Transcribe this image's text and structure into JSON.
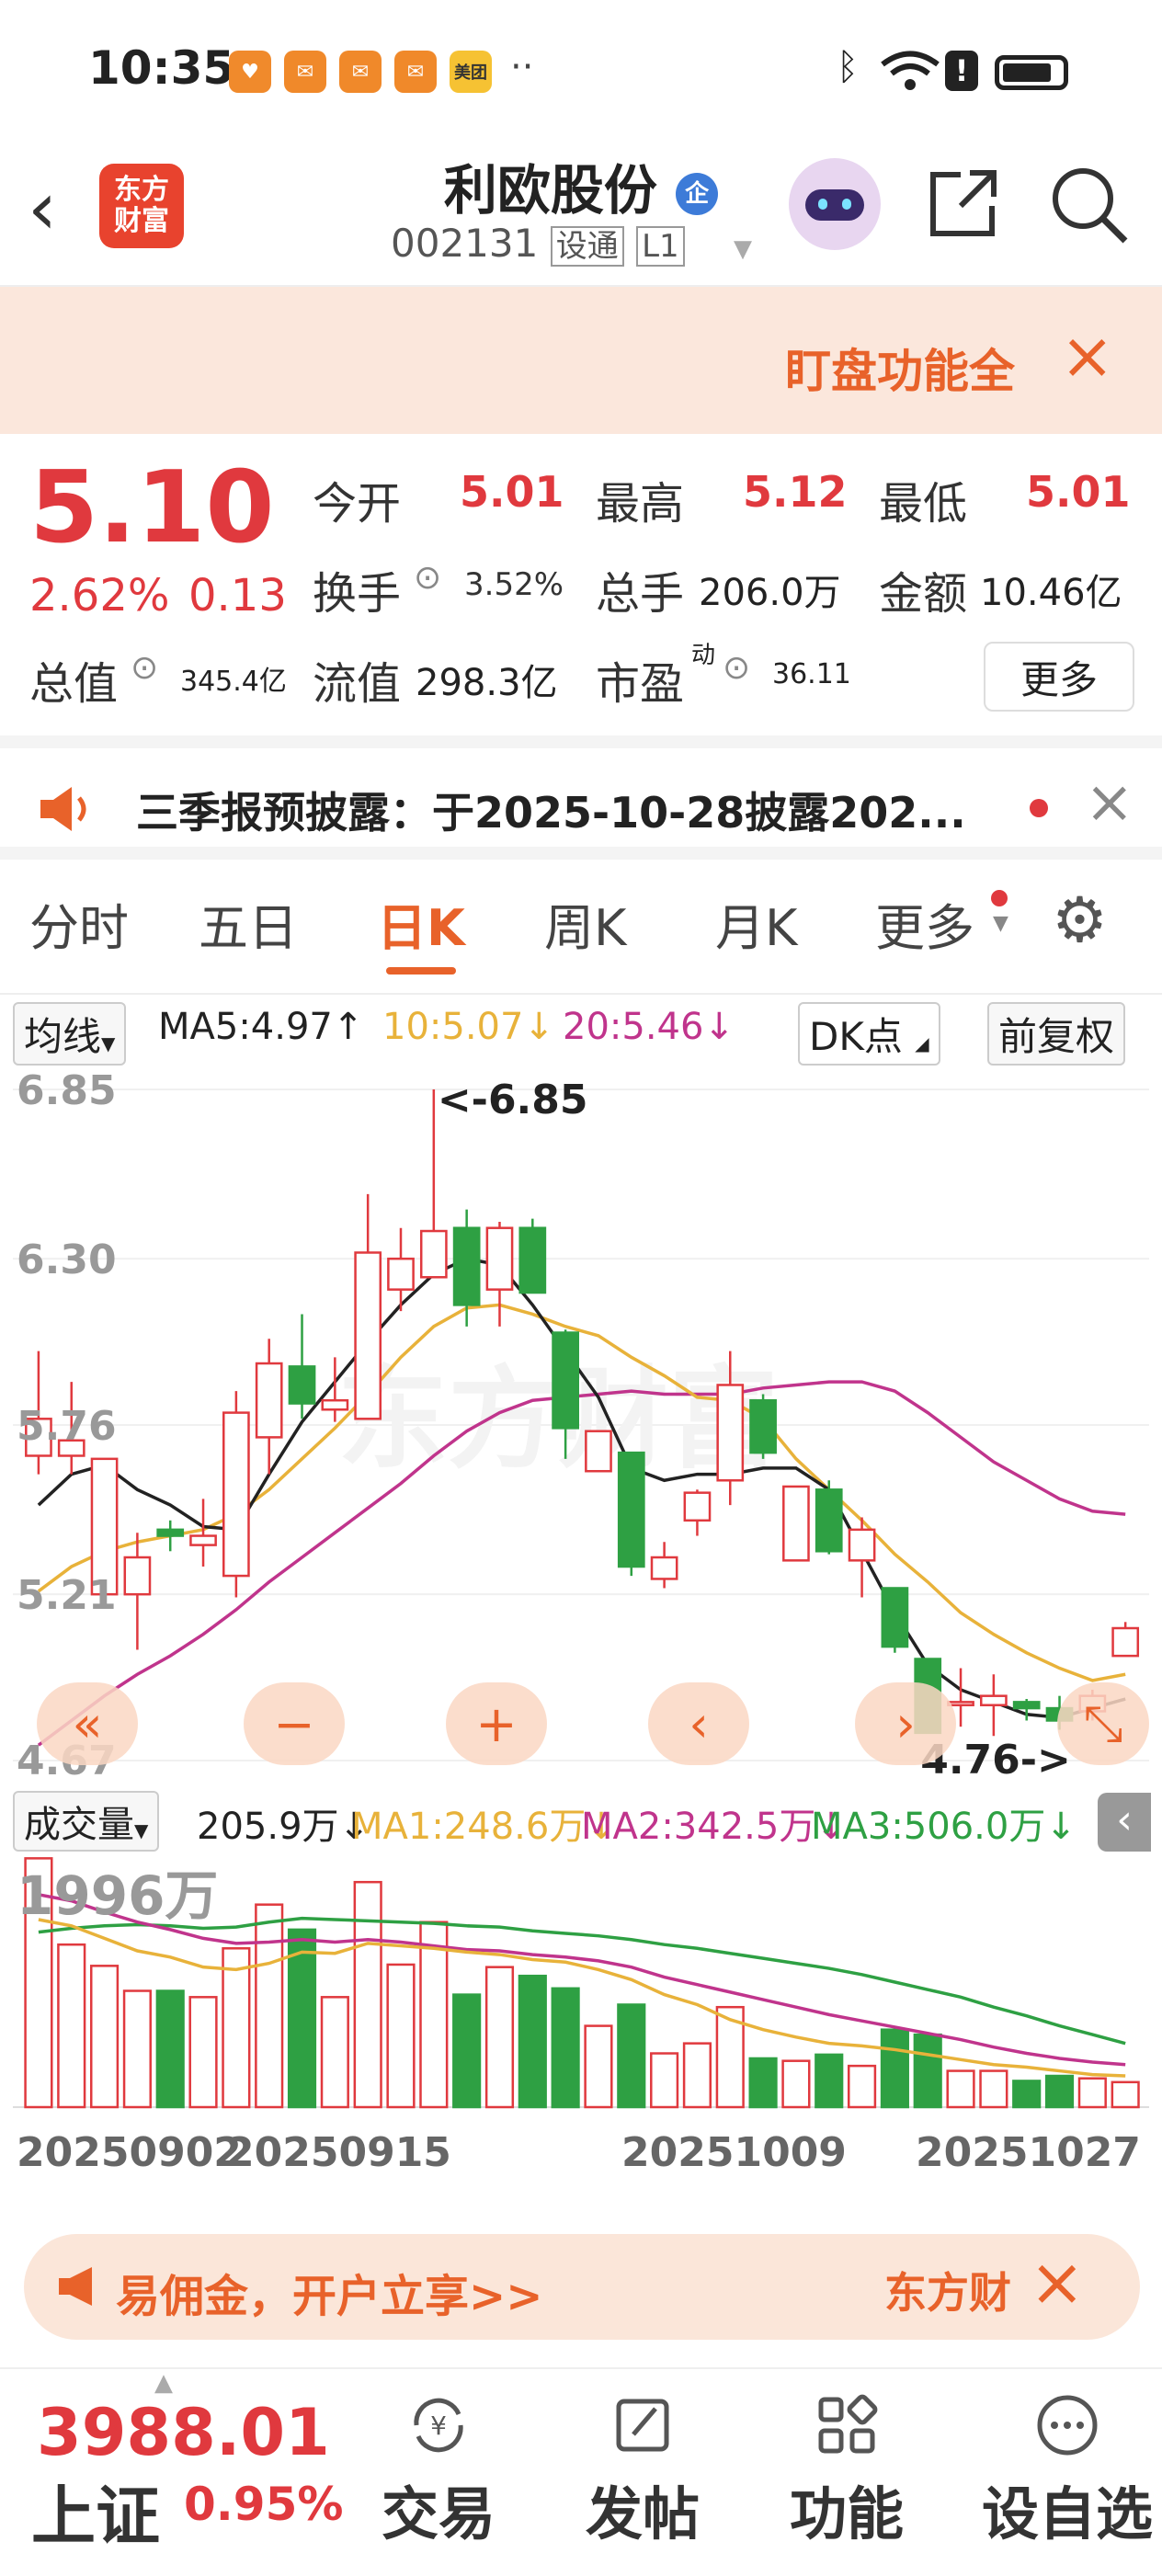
{
  "status_bar": {
    "time": "10:35",
    "notification_icons": [
      "heart-icon",
      "envelope-icon",
      "envelope-icon",
      "envelope-icon",
      "meituan-icon"
    ],
    "meituan_label": "美团",
    "more_dots": "··"
  },
  "header": {
    "logo_text": "东方\n财富",
    "stock_name": "利欧股份",
    "badge": "企",
    "code": "002131",
    "tags": [
      "设通",
      "L1"
    ]
  },
  "banner": {
    "text": "盯盘功能全"
  },
  "quote": {
    "price": "5.10",
    "change_pct": "2.62%",
    "change": "0.13",
    "open_label": "今开",
    "open": "5.01",
    "high_label": "最高",
    "high": "5.12",
    "low_label": "最低",
    "low": "5.01",
    "turnover_label": "换手",
    "turnover": "3.52%",
    "volume_label": "总手",
    "volume": "206.0万",
    "amount_label": "金额",
    "amount": "10.46亿",
    "mktcap_label": "总值",
    "mktcap": "345.4亿",
    "float_label": "流值",
    "float": "298.3亿",
    "pe_label": "市盈",
    "pe_sup": "动",
    "pe": "36.11",
    "more": "更多"
  },
  "notice": {
    "text": "三季报预披露：于2025-10-28披露202..."
  },
  "tabs": [
    "分时",
    "五日",
    "日K",
    "周K",
    "月K",
    "更多"
  ],
  "ma_row": {
    "selector": "均线",
    "ma5": "MA5:4.97↑",
    "ma10": "10:5.07↓",
    "ma20": "20:5.46↓",
    "dk": "DK点",
    "adjust": "前复权",
    "colors": {
      "ma5": "#222222",
      "ma10": "#e8b23a",
      "ma20": "#c0348c"
    }
  },
  "volume_row": {
    "selector": "成交量",
    "vol": "205.9万↓",
    "ma1": "MA1:248.6万↓",
    "ma2": "MA2:342.5万↓",
    "ma3": "MA3:506.0万↓"
  },
  "chart_data": [
    {
      "type": "candlestick",
      "y_ticks": [
        "6.85",
        "6.30",
        "5.76",
        "5.21",
        "4.67"
      ],
      "ylim": [
        4.67,
        6.85
      ],
      "annotations": [
        "<-6.85",
        "4.76->"
      ],
      "candles": [
        {
          "o": 5.66,
          "c": 5.78,
          "h": 6.0,
          "l": 5.6
        },
        {
          "o": 5.66,
          "c": 5.71,
          "h": 5.9,
          "l": 5.6
        },
        {
          "o": 5.21,
          "c": 5.65,
          "h": 5.65,
          "l": 5.2
        },
        {
          "o": 5.21,
          "c": 5.33,
          "h": 5.41,
          "l": 5.03
        },
        {
          "o": 5.42,
          "c": 5.4,
          "h": 5.45,
          "l": 5.35
        },
        {
          "o": 5.37,
          "c": 5.4,
          "h": 5.52,
          "l": 5.3
        },
        {
          "o": 5.27,
          "c": 5.8,
          "h": 5.87,
          "l": 5.2
        },
        {
          "o": 5.72,
          "c": 5.96,
          "h": 6.04,
          "l": 5.6
        },
        {
          "o": 5.95,
          "c": 5.83,
          "h": 6.12,
          "l": 5.78
        },
        {
          "o": 5.81,
          "c": 5.84,
          "h": 5.98,
          "l": 5.77
        },
        {
          "o": 5.78,
          "c": 6.32,
          "h": 6.51,
          "l": 5.78
        },
        {
          "o": 6.2,
          "c": 6.3,
          "h": 6.4,
          "l": 6.13
        },
        {
          "o": 6.24,
          "c": 6.39,
          "h": 6.85,
          "l": 6.24
        },
        {
          "o": 6.4,
          "c": 6.15,
          "h": 6.46,
          "l": 6.08
        },
        {
          "o": 6.2,
          "c": 6.4,
          "h": 6.42,
          "l": 6.08
        },
        {
          "o": 6.4,
          "c": 6.19,
          "h": 6.43,
          "l": 6.19
        },
        {
          "o": 6.06,
          "c": 5.75,
          "h": 6.07,
          "l": 5.65
        },
        {
          "o": 5.61,
          "c": 5.74,
          "h": 5.74,
          "l": 5.61
        },
        {
          "o": 5.67,
          "c": 5.3,
          "h": 5.67,
          "l": 5.27
        },
        {
          "o": 5.26,
          "c": 5.33,
          "h": 5.38,
          "l": 5.23
        },
        {
          "o": 5.45,
          "c": 5.54,
          "h": 5.55,
          "l": 5.4
        },
        {
          "o": 5.58,
          "c": 5.89,
          "h": 6.0,
          "l": 5.5
        },
        {
          "o": 5.84,
          "c": 5.67,
          "h": 5.86,
          "l": 5.65
        },
        {
          "o": 5.32,
          "c": 5.56,
          "h": 5.56,
          "l": 5.32
        },
        {
          "o": 5.55,
          "c": 5.35,
          "h": 5.58,
          "l": 5.34
        },
        {
          "o": 5.32,
          "c": 5.42,
          "h": 5.46,
          "l": 5.2
        },
        {
          "o": 5.23,
          "c": 5.04,
          "h": 5.23,
          "l": 5.02
        },
        {
          "o": 5.0,
          "c": 4.76,
          "h": 5.0,
          "l": 4.76
        },
        {
          "o": 4.85,
          "c": 4.86,
          "h": 4.97,
          "l": 4.78
        },
        {
          "o": 4.85,
          "c": 4.88,
          "h": 4.95,
          "l": 4.75
        },
        {
          "o": 4.86,
          "c": 4.84,
          "h": 4.87,
          "l": 4.8
        },
        {
          "o": 4.84,
          "c": 4.8,
          "h": 4.88,
          "l": 4.77
        },
        {
          "o": 4.83,
          "c": 4.88,
          "h": 4.9,
          "l": 4.8
        },
        {
          "o": 5.01,
          "c": 5.1,
          "h": 5.12,
          "l": 5.01
        }
      ],
      "ma5": [
        5.5,
        5.6,
        5.63,
        5.55,
        5.5,
        5.43,
        5.42,
        5.6,
        5.77,
        5.9,
        6.03,
        6.15,
        6.25,
        6.3,
        6.28,
        6.15,
        6.0,
        5.85,
        5.62,
        5.58,
        5.6,
        5.6,
        5.62,
        5.62,
        5.55,
        5.35,
        5.15,
        4.98,
        4.9,
        4.86,
        4.82,
        4.81,
        4.84,
        4.87
      ],
      "ma10": [
        5.22,
        5.3,
        5.35,
        5.38,
        5.4,
        5.42,
        5.47,
        5.55,
        5.65,
        5.75,
        5.86,
        5.98,
        6.08,
        6.14,
        6.15,
        6.12,
        6.08,
        6.05,
        5.98,
        5.92,
        5.85,
        5.84,
        5.78,
        5.65,
        5.55,
        5.45,
        5.34,
        5.25,
        5.15,
        5.08,
        5.02,
        4.97,
        4.93,
        4.95
      ],
      "ma20": [
        4.72,
        4.8,
        4.88,
        4.95,
        5.01,
        5.08,
        5.16,
        5.25,
        5.33,
        5.41,
        5.49,
        5.57,
        5.66,
        5.74,
        5.8,
        5.84,
        5.85,
        5.86,
        5.87,
        5.86,
        5.86,
        5.86,
        5.88,
        5.89,
        5.9,
        5.9,
        5.87,
        5.8,
        5.72,
        5.64,
        5.58,
        5.52,
        5.48,
        5.47
      ]
    },
    {
      "type": "bar",
      "y_tick": "1996万",
      "x_ticks": [
        "20250902",
        "20250915",
        "20251009",
        "20251027"
      ],
      "volumes": [
        1990,
        1300,
        1130,
        930,
        930,
        880,
        1270,
        1620,
        1420,
        880,
        1800,
        1140,
        1480,
        900,
        1120,
        1050,
        950,
        650,
        820,
        430,
        510,
        800,
        390,
        370,
        420,
        330,
        620,
        580,
        290,
        290,
        210,
        250,
        230,
        200
      ],
      "ma1": [
        1500,
        1450,
        1350,
        1250,
        1200,
        1120,
        1100,
        1150,
        1240,
        1230,
        1310,
        1290,
        1270,
        1240,
        1220,
        1180,
        1160,
        1100,
        1020,
        900,
        820,
        700,
        620,
        560,
        510,
        490,
        460,
        420,
        380,
        340,
        320,
        290,
        260,
        250
      ],
      "ma2": [
        1700,
        1650,
        1560,
        1480,
        1420,
        1350,
        1310,
        1320,
        1340,
        1320,
        1340,
        1320,
        1290,
        1260,
        1250,
        1220,
        1200,
        1170,
        1120,
        1040,
        980,
        920,
        860,
        800,
        740,
        690,
        640,
        590,
        540,
        480,
        430,
        390,
        360,
        340
      ],
      "ma3": [
        1400,
        1430,
        1450,
        1460,
        1450,
        1430,
        1440,
        1480,
        1510,
        1500,
        1490,
        1480,
        1470,
        1450,
        1440,
        1410,
        1390,
        1370,
        1340,
        1300,
        1270,
        1230,
        1190,
        1150,
        1110,
        1060,
        1000,
        940,
        880,
        800,
        730,
        650,
        580,
        510
      ]
    }
  ],
  "ad": {
    "text": "易佣金，开户立享>>",
    "brand": "东方财"
  },
  "bottom_nav": {
    "index_value": "3988.01",
    "index_name": "上证",
    "index_pct": "0.95%",
    "items": [
      "交易",
      "发帖",
      "功能",
      "设自选"
    ]
  }
}
